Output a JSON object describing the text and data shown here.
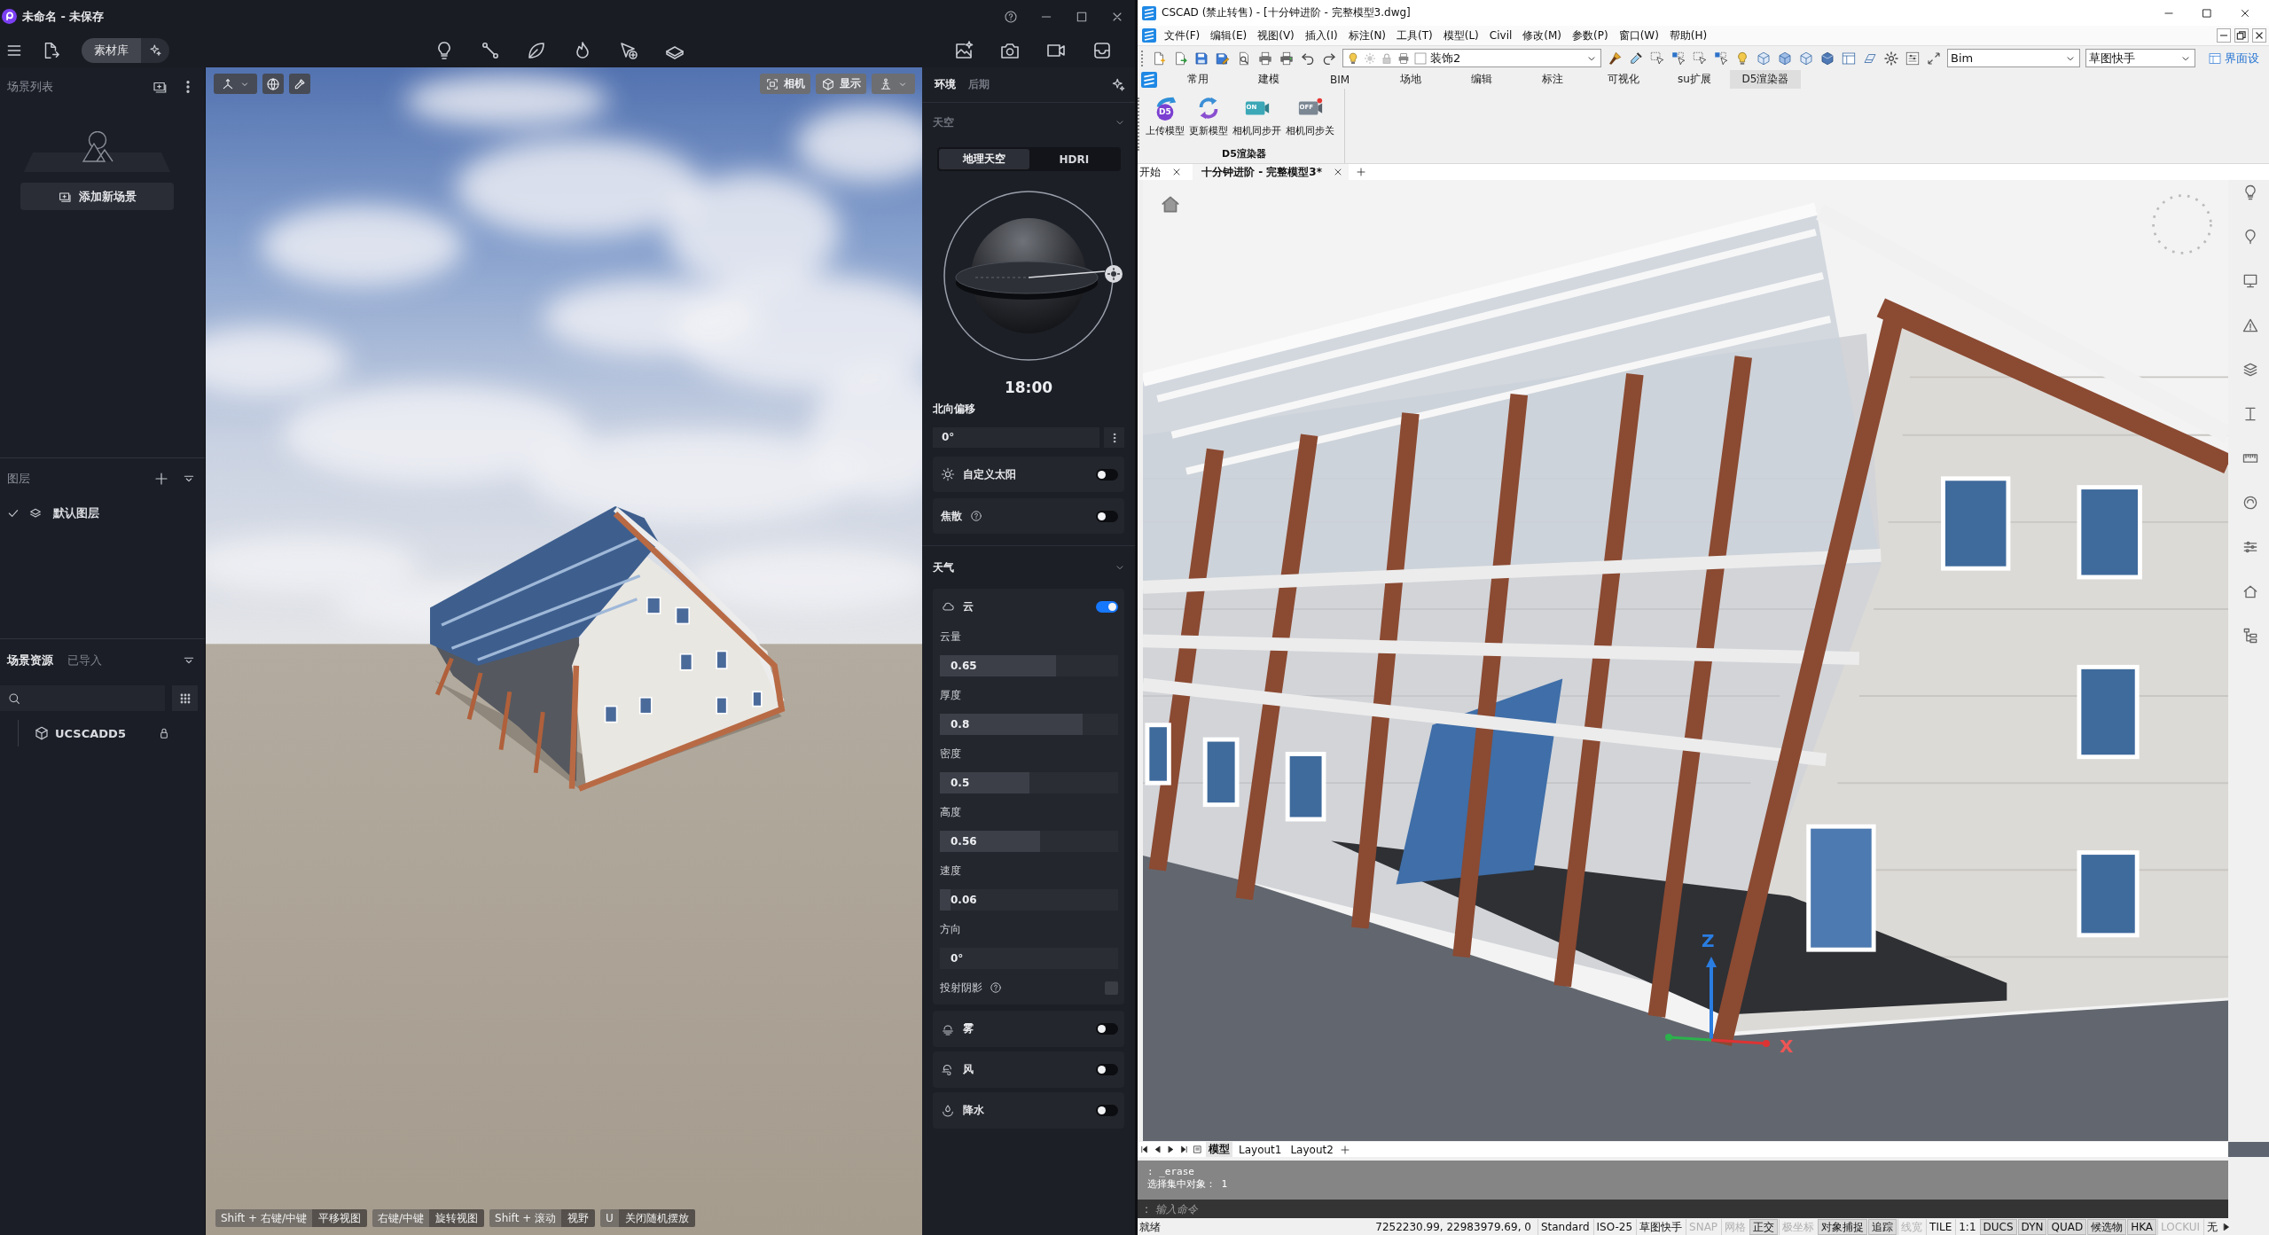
{
  "d5": {
    "title": "未命名 - 未保存",
    "library_button": "素材库",
    "scene_list": {
      "title": "场景列表",
      "add_button": "添加新场景"
    },
    "layers": {
      "title": "图层",
      "items": [
        {
          "name": "默认图层",
          "visible": true
        }
      ]
    },
    "assets": {
      "tabs": [
        {
          "label": "场景资源",
          "selected": true
        },
        {
          "label": "已导入",
          "selected": false
        }
      ],
      "items": [
        {
          "name": "UCSCADD5",
          "locked": true
        }
      ]
    },
    "viewport": {
      "buttons": [
        {
          "kind": "camera",
          "label": "相机"
        },
        {
          "kind": "display",
          "label": "显示"
        }
      ],
      "shortcuts": [
        {
          "keys": "Shift + 右键/中键",
          "action": "平移视图"
        },
        {
          "keys": "右键/中键",
          "action": "旋转视图"
        },
        {
          "keys": "Shift + 滚动",
          "action": "视野"
        },
        {
          "keys": "U",
          "action": "关闭随机摆放"
        }
      ]
    },
    "panel": {
      "tabs": [
        {
          "label": "环境",
          "selected": true
        },
        {
          "label": "后期",
          "selected": false
        }
      ],
      "sky": {
        "title": "天空",
        "modes": [
          {
            "label": "地理天空",
            "selected": true
          },
          {
            "label": "HDRI",
            "selected": false
          }
        ],
        "time": "18:00",
        "north_offset": {
          "label": "北向偏移",
          "value": "0°"
        },
        "options": [
          {
            "kind": "sun",
            "label": "自定义太阳",
            "help": false,
            "on": false
          },
          {
            "kind": "caustics",
            "label": "焦散",
            "help": true,
            "on": false
          }
        ]
      },
      "weather": {
        "title": "天气",
        "cloud": {
          "label": "云",
          "on": true,
          "params": [
            {
              "kind": "slider",
              "label": "云量",
              "value": "0.65",
              "level": 0.65
            },
            {
              "kind": "slider",
              "label": "厚度",
              "value": "0.8",
              "level": 0.8
            },
            {
              "kind": "slider",
              "label": "密度",
              "value": "0.5",
              "level": 0.5
            },
            {
              "kind": "slider",
              "label": "高度",
              "value": "0.56",
              "level": 0.56
            },
            {
              "kind": "slider",
              "label": "速度",
              "value": "0.06",
              "level": 0.06
            },
            {
              "kind": "field",
              "label": "方向",
              "value": "0°"
            },
            {
              "kind": "checkbox",
              "label": "投射阴影",
              "help": true,
              "checked": false
            }
          ]
        },
        "effects": [
          {
            "kind": "fog",
            "label": "雾",
            "on": false
          },
          {
            "kind": "wind",
            "label": "风",
            "on": false
          },
          {
            "kind": "rain",
            "label": "降水",
            "on": false
          }
        ]
      }
    }
  },
  "cad": {
    "title": "CSCAD (禁止转售) - [十分钟进阶 - 完整模型3.dwg]",
    "menu": [
      "文件(F)",
      "编辑(E)",
      "视图(V)",
      "插入(I)",
      "标注(N)",
      "工具(T)",
      "模型(L)",
      "Civil",
      "修改(M)",
      "参数(P)",
      "窗口(W)",
      "帮助(H)"
    ],
    "toolbar": {
      "layer": "装饰2",
      "workspace": "Bim",
      "mode": "草图快手",
      "interface_button": "界面设"
    },
    "ribbon_tabs": [
      {
        "label": "常用",
        "selected": false
      },
      {
        "label": "建模",
        "selected": false
      },
      {
        "label": "BIM",
        "selected": false
      },
      {
        "label": "场地",
        "selected": false
      },
      {
        "label": "编辑",
        "selected": false
      },
      {
        "label": "标注",
        "selected": false
      },
      {
        "label": "可视化",
        "selected": false
      },
      {
        "label": "su扩展",
        "selected": false
      },
      {
        "label": "D5渲染器",
        "selected": true
      }
    ],
    "ribbon": {
      "buttons": [
        {
          "kind": "upload",
          "label": "上传模型",
          "icon_text": "D5"
        },
        {
          "kind": "update",
          "label": "更新模型"
        },
        {
          "kind": "camera_on",
          "label": "相机同步开",
          "icon_text": "ON"
        },
        {
          "kind": "camera_off",
          "label": "相机同步关",
          "icon_text": "OFF"
        }
      ],
      "group": "D5渲染器"
    },
    "doc_tabs": [
      {
        "label": "开始",
        "selected": false
      },
      {
        "label": "十分钟进阶 - 完整模型3*",
        "selected": true
      }
    ],
    "viewport": {
      "axes": {
        "z_label": "Z",
        "x_label": "X"
      }
    },
    "layout_tabs": [
      {
        "label": "模型",
        "selected": true
      },
      {
        "label": "Layout1",
        "selected": false
      },
      {
        "label": "Layout2",
        "selected": false
      }
    ],
    "command": {
      "history": [
        ": _erase",
        "选择集中对象： 1"
      ],
      "prompt": ":",
      "placeholder": "输入命令"
    },
    "status_bar": {
      "state": "就绪",
      "coordinates": "7252230.99, 22983979.69, 0",
      "items": [
        {
          "kind": "text",
          "label": "Standard"
        },
        {
          "kind": "text",
          "label": "ISO-25"
        },
        {
          "kind": "text",
          "label": "草图快手"
        },
        {
          "kind": "toggle",
          "label": "SNAP",
          "on": false
        },
        {
          "kind": "toggle",
          "label": "网格",
          "on": false
        },
        {
          "kind": "toggle",
          "label": "正交",
          "on": true
        },
        {
          "kind": "toggle",
          "label": "极坐标",
          "on": false
        },
        {
          "kind": "toggle",
          "label": "对象捕捉",
          "on": true
        },
        {
          "kind": "toggle",
          "label": "追踪",
          "on": true
        },
        {
          "kind": "toggle",
          "label": "线宽",
          "on": false
        },
        {
          "kind": "text",
          "label": "TILE"
        },
        {
          "kind": "text",
          "label": "1:1"
        },
        {
          "kind": "toggle",
          "label": "DUCS",
          "on": true
        },
        {
          "kind": "toggle",
          "label": "DYN",
          "on": true
        },
        {
          "kind": "toggle",
          "label": "QUAD",
          "on": true
        },
        {
          "kind": "toggle",
          "label": "候选物",
          "on": true
        },
        {
          "kind": "toggle",
          "label": "HKA",
          "on": true
        },
        {
          "kind": "toggle",
          "label": "LOCKUI",
          "on": false
        },
        {
          "kind": "text",
          "label": "无"
        }
      ]
    }
  }
}
